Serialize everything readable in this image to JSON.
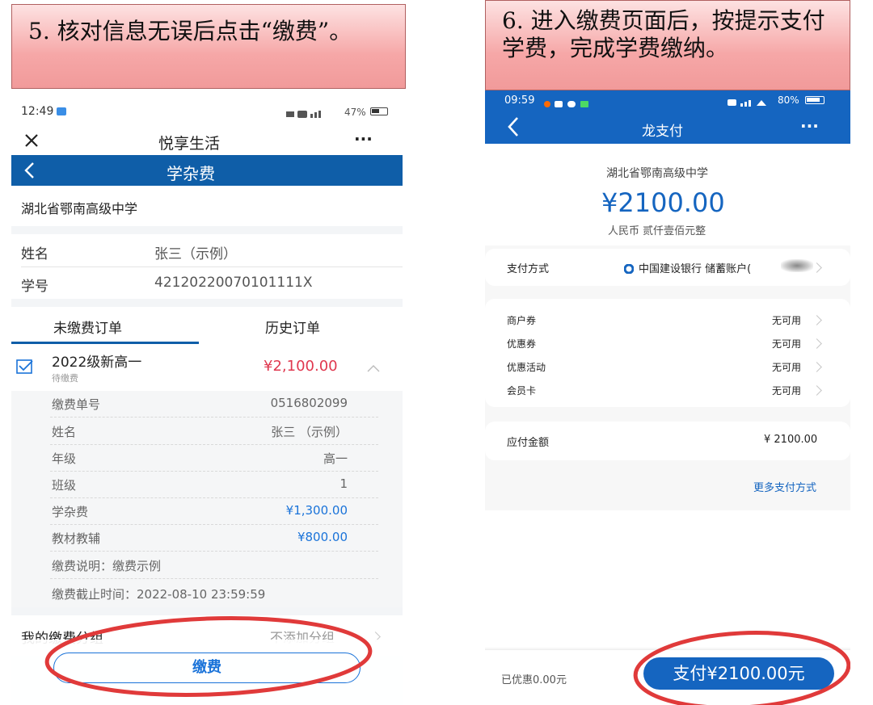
{
  "step5": {
    "text": "5. 核对信息无误后点击“缴费”。"
  },
  "step6": {
    "line1": "6. 进入缴费页面后，按提示支付",
    "line2": "学费，完成学费缴纳。"
  },
  "left": {
    "status": {
      "time": "12:49",
      "battery": "47%"
    },
    "titlebar": {
      "title": "悦享生活",
      "close_icon": "close-icon",
      "more": "···"
    },
    "navbar": {
      "title": "学杂费"
    },
    "school": "湖北省鄂南高级中学",
    "student": {
      "name_label": "姓名",
      "name_value": "张三（示例）",
      "id_label": "学号",
      "id_value": "42120220070101111X"
    },
    "tabs": {
      "unpaid": "未缴费订单",
      "history": "历史订单"
    },
    "order": {
      "title": "2022级新高一",
      "status": "待缴费",
      "amount": "¥2,100.00"
    },
    "details": [
      {
        "label": "缴费单号",
        "value": "0516802099"
      },
      {
        "label": "姓名",
        "value": "张三 （示例）"
      },
      {
        "label": "年级",
        "value": "高一"
      },
      {
        "label": "班级",
        "value": "1"
      },
      {
        "label": "学杂费",
        "value": "¥1,300.00"
      },
      {
        "label": "教材教辅",
        "value": "¥800.00"
      }
    ],
    "note": "缴费说明：缴费示例",
    "deadline": "缴费截止时间：2022-08-10 23:59:59",
    "group": {
      "label": "我的缴费分组",
      "value": "不添加分组"
    },
    "pay_button": "缴费",
    "accent": "#0f5ea8",
    "amount_color": "#e0384f",
    "blue_amount_color": "#1a73d9"
  },
  "right": {
    "status": {
      "time": "09:59",
      "battery": "80%"
    },
    "titlebar": {
      "title": "龙支付",
      "more": "···"
    },
    "school": "湖北省鄂南高级中学",
    "amount": "¥2100.00",
    "amount_words": "人民币  贰仟壹佰元整",
    "pay_method": {
      "label": "支付方式",
      "value": "中国建设银行 储蓄账户("
    },
    "coupons": [
      {
        "label": "商户券",
        "value": "无可用"
      },
      {
        "label": "优惠券",
        "value": "无可用"
      },
      {
        "label": "优惠活动",
        "value": "无可用"
      },
      {
        "label": "会员卡",
        "value": "无可用"
      }
    ],
    "due": {
      "label": "应付金额",
      "value": "¥ 2100.00"
    },
    "more_methods": "更多支付方式",
    "discount": "已优惠0.00元",
    "pay_button": "支付¥2100.00元",
    "accent": "#1565c0"
  }
}
